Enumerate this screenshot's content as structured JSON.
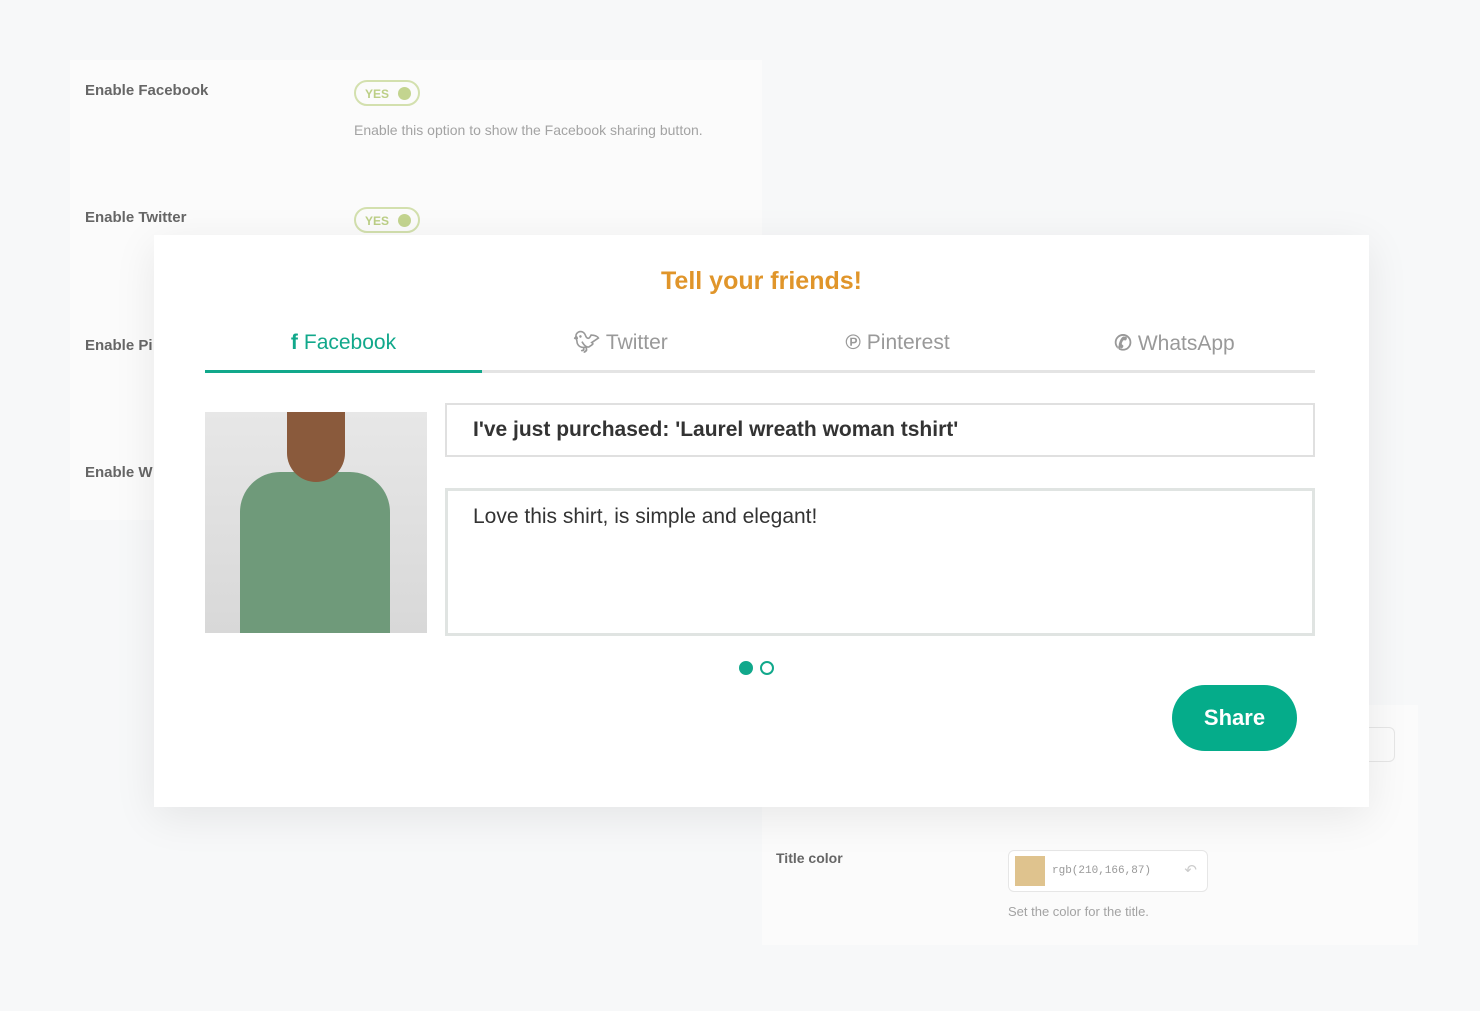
{
  "settings": [
    {
      "label": "Enable Facebook",
      "toggle": "YES",
      "help": "Enable this option to show the Facebook sharing button."
    },
    {
      "label": "Enable Twitter",
      "toggle": "YES"
    },
    {
      "label": "Enable Pi"
    },
    {
      "label": "Enable W"
    }
  ],
  "title_color": {
    "label": "Title color",
    "value": "rgb(210,166,87)",
    "help": "Set the color for the title.",
    "swatch": "#d2a657"
  },
  "modal": {
    "title": "Tell your friends!",
    "tabs": [
      {
        "label": "Facebook",
        "icon": "facebook-icon"
      },
      {
        "label": "Twitter",
        "icon": "twitter-icon"
      },
      {
        "label": "Pinterest",
        "icon": "pinterest-icon"
      },
      {
        "label": "WhatsApp",
        "icon": "whatsapp-icon"
      }
    ],
    "active_tab": "Facebook",
    "headline": "I've just purchased: 'Laurel wreath woman tshirt'",
    "message": "Love this shirt, is simple and elegant!",
    "pagination": {
      "current": 1,
      "total": 2
    },
    "share_label": "Share",
    "accent": "#11a88b",
    "title_color": "#e0952a"
  }
}
